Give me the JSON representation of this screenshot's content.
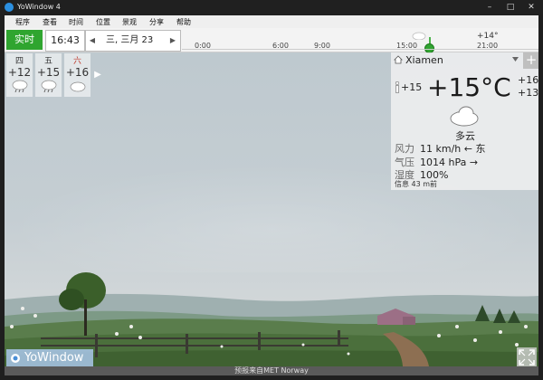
{
  "window": {
    "title": "YoWindow 4",
    "minimize": "–",
    "maximize": "□",
    "close": "✕"
  },
  "menu": [
    "程序",
    "查看",
    "时间",
    "位置",
    "景观",
    "分享",
    "帮助"
  ],
  "timebar": {
    "now_label": "实时",
    "time": "16:43",
    "date": "三, 三月 23",
    "ticks": [
      "0:00",
      "6:00",
      "9:00",
      "15:00",
      "21:00"
    ],
    "timeline_temp": "+14°"
  },
  "forecast": [
    {
      "day": "四",
      "temp": "+12",
      "icon": "rain-icon",
      "day_color": "#333333"
    },
    {
      "day": "五",
      "temp": "+15",
      "icon": "rain-icon",
      "day_color": "#333333"
    },
    {
      "day": "六",
      "temp": "+16",
      "icon": "cloud-icon",
      "day_color": "#c0392b"
    }
  ],
  "current": {
    "city": "Xiamen",
    "feels_like": "+15",
    "temperature": "+15°C",
    "high": "+16",
    "low": "+13",
    "condition": "多云",
    "wind_label": "风力",
    "wind_value": "11 km/h ← 东",
    "pressure_label": "气压",
    "pressure_value": "1014 hPa →",
    "humidity_label": "湿度",
    "humidity_value": "100%",
    "updated": "信息 43 m前"
  },
  "logo_text": "YoWindow",
  "credit": "预报来自MET Norway"
}
